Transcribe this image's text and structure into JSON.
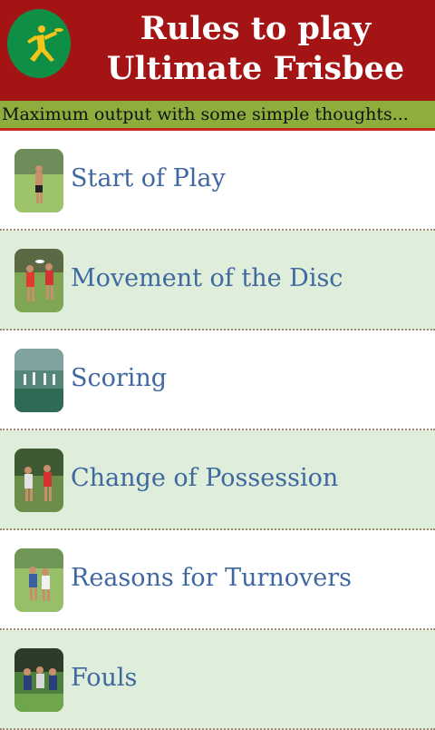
{
  "header": {
    "title": "Rules to play Ultimate Frisbee",
    "logo_icon": "frisbee-player-icon",
    "background": "#a51414",
    "logo_color": "#0f8f45"
  },
  "tagline": {
    "text": "Maximum output with some simple thoughts...",
    "background": "#8dae3d"
  },
  "menu": {
    "items": [
      {
        "label": "Start of Play",
        "icon": "start-of-play-photo"
      },
      {
        "label": "Movement of the Disc",
        "icon": "movement-of-disc-photo"
      },
      {
        "label": "Scoring",
        "icon": "scoring-photo"
      },
      {
        "label": "Change of Possession",
        "icon": "change-of-possession-photo"
      },
      {
        "label": "Reasons for Turnovers",
        "icon": "reasons-for-turnovers-photo"
      },
      {
        "label": "Fouls",
        "icon": "fouls-photo"
      }
    ],
    "row_colors": [
      "#ffffff",
      "#deeedb"
    ],
    "label_color": "#3f67a0"
  }
}
